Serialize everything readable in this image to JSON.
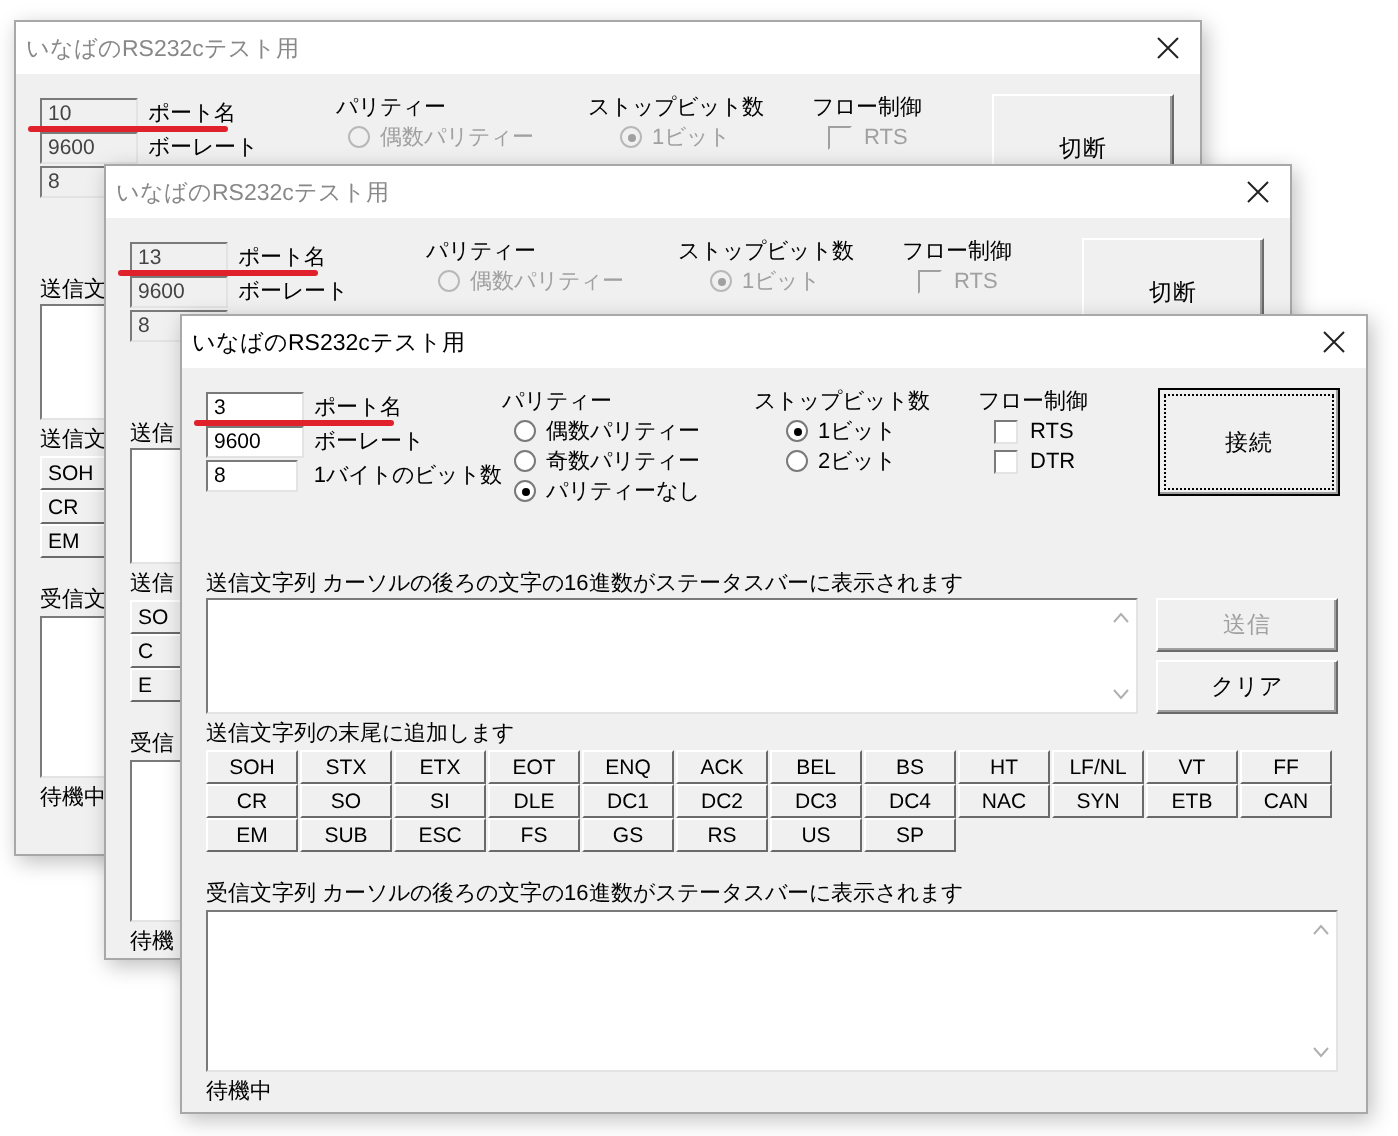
{
  "windows": [
    {
      "title": "いなばのRS232cテスト用",
      "port": {
        "value": "10",
        "label": "ポート名",
        "disabled": true
      },
      "baud": {
        "value": "9600",
        "label": "ボーレート",
        "disabled": true
      },
      "bits": {
        "value": "8",
        "disabled": true
      },
      "parity": {
        "label": "パリティー",
        "options": [
          {
            "label": "偶数パリティー",
            "selected": false,
            "disabled": true
          }
        ]
      },
      "stop_bits": {
        "label": "ストップビット数",
        "options": [
          {
            "label": "1ビット",
            "selected": true,
            "disabled": true
          }
        ]
      },
      "flow_control": {
        "label": "フロー制御",
        "options": [
          {
            "label": "RTS",
            "checked": false,
            "disabled": true
          }
        ]
      },
      "connect_button": {
        "label": "切断",
        "focused": false
      },
      "send": {
        "label": "送信文"
      },
      "append": {
        "label": "送信文",
        "code_rows": [
          [
            "SOH"
          ],
          [
            "CR"
          ],
          [
            "EM"
          ]
        ]
      },
      "receive": {
        "label": "受信文"
      },
      "status": "待機中"
    },
    {
      "title": "いなばのRS232cテスト用",
      "port": {
        "value": "13",
        "label": "ポート名",
        "disabled": true
      },
      "baud": {
        "value": "9600",
        "label": "ボーレート",
        "disabled": true
      },
      "bits": {
        "value": "8",
        "disabled": true
      },
      "parity": {
        "label": "パリティー",
        "options": [
          {
            "label": "偶数パリティー",
            "selected": false,
            "disabled": true
          }
        ]
      },
      "stop_bits": {
        "label": "ストップビット数",
        "options": [
          {
            "label": "1ビット",
            "selected": true,
            "disabled": true
          }
        ]
      },
      "flow_control": {
        "label": "フロー制御",
        "options": [
          {
            "label": "RTS",
            "checked": false,
            "disabled": true
          }
        ]
      },
      "connect_button": {
        "label": "切断",
        "focused": false
      },
      "send": {
        "label": "送信"
      },
      "append": {
        "label": "送信",
        "code_rows": [
          [
            "SO"
          ],
          [
            "C"
          ],
          [
            "E"
          ]
        ]
      },
      "receive": {
        "label": "受信"
      },
      "status": "待機"
    },
    {
      "title": "いなばのRS232cテスト用",
      "port": {
        "value": "3",
        "label": "ポート名",
        "disabled": false
      },
      "baud": {
        "value": "9600",
        "label": "ボーレート",
        "disabled": false
      },
      "bits": {
        "value": "8",
        "label": "1バイトのビット数",
        "disabled": false
      },
      "parity": {
        "label": "パリティー",
        "options": [
          {
            "label": "偶数パリティー",
            "selected": false,
            "disabled": false
          },
          {
            "label": "奇数パリティー",
            "selected": false,
            "disabled": false
          },
          {
            "label": "パリティーなし",
            "selected": true,
            "disabled": false
          }
        ]
      },
      "stop_bits": {
        "label": "ストップビット数",
        "options": [
          {
            "label": "1ビット",
            "selected": true,
            "disabled": false
          },
          {
            "label": "2ビット",
            "selected": false,
            "disabled": false
          }
        ]
      },
      "flow_control": {
        "label": "フロー制御",
        "options": [
          {
            "label": "RTS",
            "checked": false,
            "disabled": false
          },
          {
            "label": "DTR",
            "checked": false,
            "disabled": false
          }
        ]
      },
      "connect_button": {
        "label": "接続",
        "focused": true
      },
      "send": {
        "label": "送信文字列  カーソルの後ろの文字の16進数がステータスバーに表示されます",
        "send_button": {
          "label": "送信",
          "disabled": true
        },
        "clear_button": {
          "label": "クリア"
        }
      },
      "append": {
        "label": "送信文字列の末尾に追加します",
        "code_rows": [
          [
            "SOH",
            "STX",
            "ETX",
            "EOT",
            "ENQ",
            "ACK",
            "BEL",
            "BS",
            "HT",
            "LF/NL",
            "VT",
            "FF"
          ],
          [
            "CR",
            "SO",
            "SI",
            "DLE",
            "DC1",
            "DC2",
            "DC3",
            "DC4",
            "NAC",
            "SYN",
            "ETB",
            "CAN"
          ],
          [
            "EM",
            "SUB",
            "ESC",
            "FS",
            "GS",
            "RS",
            "US",
            "SP"
          ]
        ]
      },
      "receive": {
        "label": "受信文字列  カーソルの後ろの文字の16進数がステータスバーに表示されます"
      },
      "status": "待機中"
    }
  ]
}
